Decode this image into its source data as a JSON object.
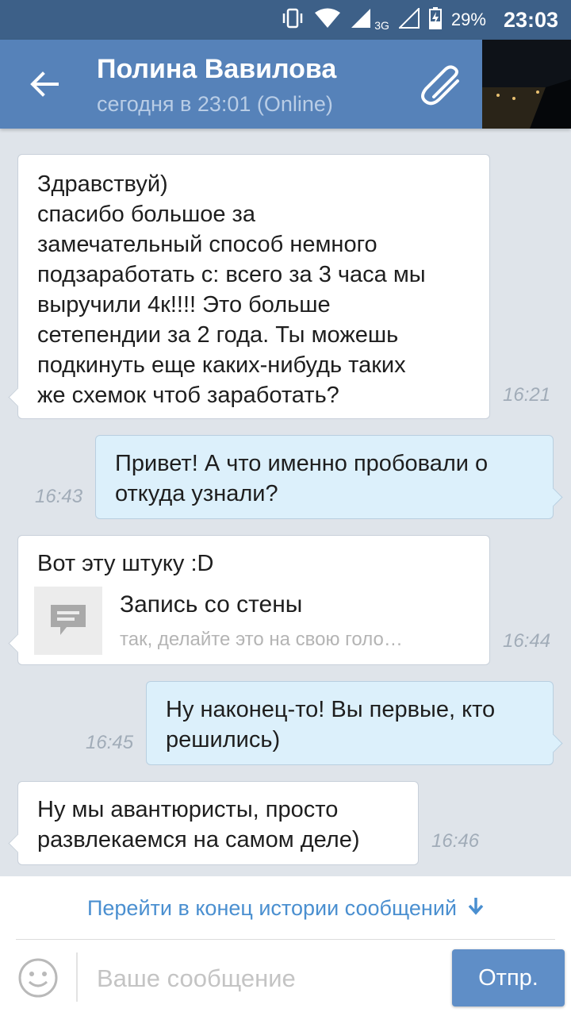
{
  "status_bar": {
    "network_label": "3G",
    "battery_percent": "29%",
    "time": "23:03"
  },
  "header": {
    "contact_name": "Полина Вавилова",
    "last_seen": "сегодня в 23:01 (Online)"
  },
  "messages": [
    {
      "direction": "in",
      "text": "Здравствуй)\nспасибо большое за\nзамечательный способ немного\nподзаработать с: всего за 3 часа мы\nвыручили 4к!!!! Это больше\nсетепендии за 2 года. Ты можешь\nподкинуть еще каких-нибудь таких\nже схемок чтоб заработать?",
      "time": "16:21"
    },
    {
      "direction": "out",
      "text": "Привет! А что именно пробовали о\nоткуда узнали?",
      "time": "16:43"
    },
    {
      "direction": "in",
      "text": "Вот эту штуку :D",
      "attachment": {
        "type": "wall-post",
        "title": "Запись со стены",
        "preview": "так, делайте это на свою голо…"
      },
      "time": "16:44"
    },
    {
      "direction": "out",
      "text": "Ну наконец-то! Вы первые, кто\nрешились)",
      "time": "16:45"
    },
    {
      "direction": "in",
      "text": "Ну мы авантюристы, просто\nразвлекаемся на самом деле)",
      "time": "16:46"
    }
  ],
  "jump_to_end": {
    "label": "Перейти в конец истории сообщений"
  },
  "composer": {
    "placeholder": "Ваше сообщение",
    "send_label": "Отпр."
  },
  "colors": {
    "status_bar": "#3d6088",
    "header": "#5682b9",
    "chat_background": "#dfe4ea",
    "incoming_bubble": "#ffffff",
    "outgoing_bubble": "#dcf0fb",
    "link": "#4a8fd0",
    "send_button": "#5f8ec7"
  }
}
